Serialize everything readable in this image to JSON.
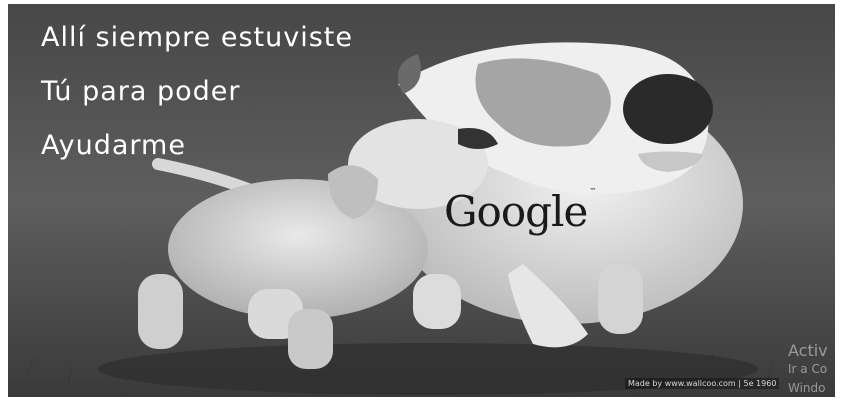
{
  "caption": {
    "line1": "Allí siempre estuviste",
    "line2": "Tú para poder",
    "line3": "Ayudarme"
  },
  "logo": {
    "text": "Google",
    "mark": "™"
  },
  "credit": {
    "text": "Made by www.wallcoo.com | 5e 1960"
  },
  "activation": {
    "line1": "Activ",
    "line2": "Ir a Co",
    "line3": "Windo"
  },
  "colors": {
    "caption": "#ffffff",
    "logo": "#1a1a1a"
  }
}
